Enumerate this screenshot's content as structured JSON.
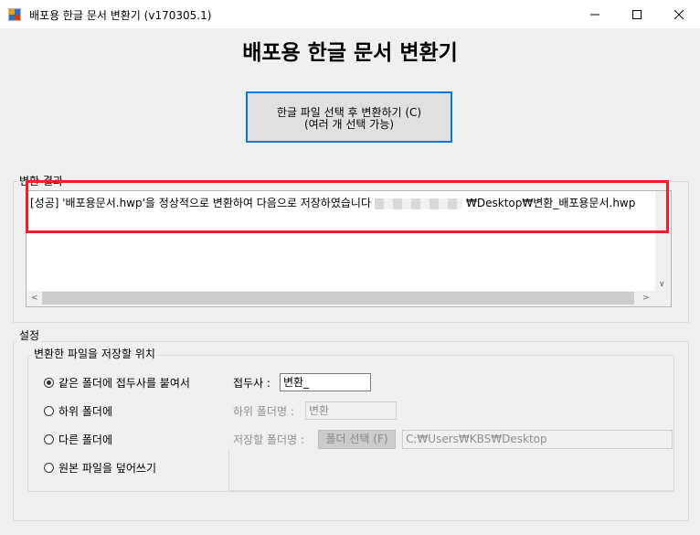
{
  "window": {
    "title": "배포용 한글 문서 변환기 (v170305.1)",
    "app_icon": "app-window-icon",
    "controls": [
      "minimize-icon",
      "maximize-icon",
      "close-icon"
    ]
  },
  "header": {
    "title": "배포용 한글 문서 변환기"
  },
  "convert_button": {
    "line1": "한글 파일 선택 후 변환하기 (C)",
    "line2": "(여러 개 선택 가능)"
  },
  "results": {
    "label": "변환 결과",
    "line_prefix": "[성공] '배포용문서.hwp'을 정상적으로 변환하여 다음으로 저장하였습니다",
    "line_suffix": "₩Desktop₩변환_배포용문서.hwp"
  },
  "settings": {
    "label": "설정",
    "location_label": "변환한 파일을 저장할 위치",
    "options": [
      {
        "label": "같은 폴더에 접두사를 붙여서",
        "selected": true
      },
      {
        "label": "하위 폴더에",
        "selected": false
      },
      {
        "label": "다른 폴더에",
        "selected": false
      },
      {
        "label": "원본 파일을 덮어쓰기",
        "selected": false
      }
    ],
    "prefix_label": "접두사 :",
    "prefix_value": "변환_",
    "subfolder_label": "하위 폴더명 :",
    "subfolder_value": "변환",
    "save_folder_label": "저장할 폴더명 :",
    "folder_button": "폴더 선택 (F)",
    "folder_path": "C:₩Users₩KBS₩Desktop"
  },
  "colors": {
    "accent": "#0078d7",
    "highlight": "#e8202a"
  }
}
